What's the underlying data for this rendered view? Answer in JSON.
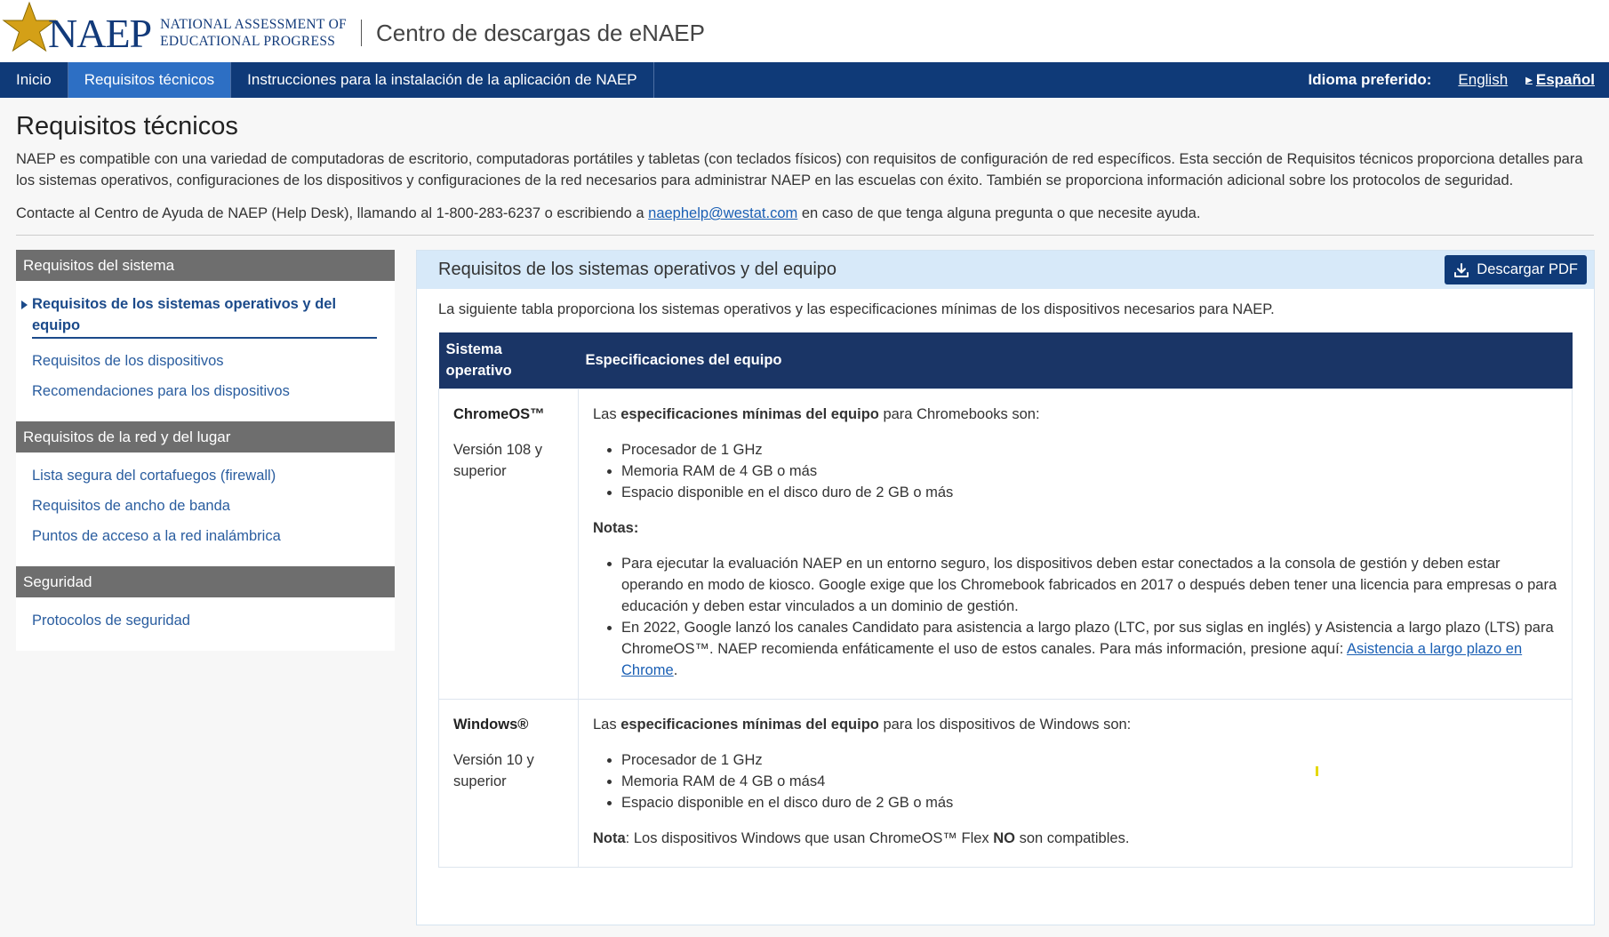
{
  "header": {
    "logo_naep": "NAEP",
    "logo_sub_line1": "NATIONAL ASSESSMENT OF",
    "logo_sub_line2": "EDUCATIONAL PROGRESS",
    "site_title": "Centro de descargas de eNAEP"
  },
  "nav": {
    "items": [
      {
        "label": "Inicio"
      },
      {
        "label": "Requisitos técnicos"
      },
      {
        "label": "Instrucciones para la instalación de la aplicación de NAEP"
      }
    ],
    "language_label": "Idioma preferido:",
    "lang_english": "English",
    "lang_espanol": "Español"
  },
  "main": {
    "title": "Requisitos técnicos",
    "intro": "NAEP es compatible con una variedad de computadoras de escritorio, computadoras portátiles y tabletas (con teclados físicos) con requisitos de configuración de red específicos. Esta sección de Requisitos técnicos proporciona detalles para los sistemas operativos, configuraciones de los dispositivos y configuraciones de la red necesarios para administrar NAEP en las escuelas con éxito. También se proporciona información adicional sobre los protocolos de seguridad.",
    "contact_before": "Contacte al Centro de Ayuda de NAEP (Help Desk), llamando al 1-800-283-6237 o escribiendo a ",
    "contact_email": "naephelp@westat.com",
    "contact_after": " en caso de que tenga alguna pregunta o que necesite ayuda."
  },
  "sidebar": {
    "sections": [
      {
        "heading": "Requisitos del sistema",
        "links": [
          "Requisitos de los sistemas operativos y del equipo",
          "Requisitos de los dispositivos",
          "Recomendaciones para los dispositivos"
        ]
      },
      {
        "heading": "Requisitos de la red y del lugar",
        "links": [
          "Lista segura del cortafuegos (firewall)",
          "Requisitos de ancho de banda",
          "Puntos de acceso a la red inalámbrica"
        ]
      },
      {
        "heading": "Seguridad",
        "links": [
          "Protocolos de seguridad"
        ]
      }
    ]
  },
  "panel": {
    "title": "Requisitos de los sistemas operativos y del equipo",
    "download_button": "Descargar PDF",
    "description": "La siguiente tabla proporciona los sistemas operativos y las especificaciones mínimas de los dispositivos necesarios para NAEP.",
    "table": {
      "col1": "Sistema operativo",
      "col2": "Especificaciones del equipo",
      "rows": [
        {
          "os": "ChromeOS™",
          "version": "Versión 108 y superior",
          "spec_pre": "Las ",
          "spec_bold": "especificaciones mínimas del equipo",
          "spec_post": " para Chromebooks son:",
          "bullets": [
            "Procesador de 1 GHz",
            "Memoria RAM de 4 GB o más",
            "Espacio disponible en el disco duro de 2 GB o más"
          ],
          "notes_label": "Notas:",
          "note1": "Para ejecutar la evaluación NAEP en un entorno seguro, los dispositivos deben estar conectados a la consola de gestión y deben estar operando en modo de kiosco. Google exige que los Chromebook fabricados en 2017 o después deben tener una licencia para empresas o para educación y deben estar vinculados a un dominio de gestión.",
          "note2_text": "En 2022, Google lanzó los canales Candidato para asistencia a largo plazo (LTC, por sus siglas en inglés) y Asistencia a largo plazo (LTS) para ChromeOS™. NAEP recomienda enfáticamente el uso de estos canales. Para más información, presione aquí: ",
          "note2_link": "Asistencia a largo plazo en Chrome",
          "note2_end": "."
        },
        {
          "os": "Windows®",
          "version": "Versión 10 y superior",
          "spec_pre": "Las ",
          "spec_bold": "especificaciones mínimas del equipo",
          "spec_post": " para los dispositivos de Windows son:",
          "bullets": [
            "Procesador de 1 GHz",
            "Memoria RAM de 4 GB o más4",
            "Espacio disponible en el disco duro de 2 GB o más"
          ],
          "note_label": "Nota",
          "note_pre": ": Los dispositivos Windows que usan ChromeOS™ Flex ",
          "note_bold": "NO",
          "note_post": " son compatibles."
        }
      ]
    }
  },
  "colors": {
    "nav_bg": "#0f3a78",
    "nav_active": "#2d6fc4",
    "sidebar_head": "#6e6e6e",
    "panel_head": "#d7e9f9",
    "table_head": "#1a3566",
    "link": "#2a5d9f",
    "logo_star": "#d4a017"
  },
  "icons": {
    "logo_star": "star-icon",
    "download": "download-icon"
  }
}
